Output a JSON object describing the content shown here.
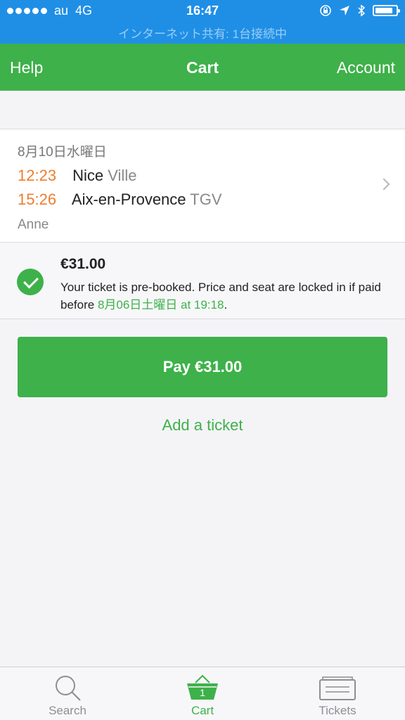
{
  "status_bar": {
    "carrier": "au",
    "network": "4G",
    "time": "16:47",
    "hotspot": "インターネット共有: 1台接続中",
    "battery_level": 0.85
  },
  "nav": {
    "left": "Help",
    "title": "Cart",
    "right": "Account"
  },
  "trip": {
    "date": "8月10日水曜日",
    "departure_time": "12:23",
    "departure_station": "Nice",
    "departure_station_suffix": "Ville",
    "arrival_time": "15:26",
    "arrival_station": "Aix-en-Provence",
    "arrival_station_suffix": "TGV",
    "passenger": "Anne"
  },
  "booking": {
    "price": "€31.00",
    "notice_text": "Your ticket is pre-booked. Price and seat are locked in if paid before",
    "deadline": "8月06日土曜日 at 19:18",
    "notice_end": "."
  },
  "actions": {
    "pay_label": "Pay €31.00",
    "add_ticket_label": "Add a ticket"
  },
  "tabs": [
    {
      "label": "Search",
      "icon": "search-icon",
      "active": false
    },
    {
      "label": "Cart",
      "icon": "cart-icon",
      "badge": "1",
      "active": true
    },
    {
      "label": "Tickets",
      "icon": "tickets-icon",
      "active": false
    }
  ],
  "colors": {
    "status_bar": "#1f8fe6",
    "brand_green": "#3eb14a",
    "time_orange": "#ee7d2e"
  }
}
